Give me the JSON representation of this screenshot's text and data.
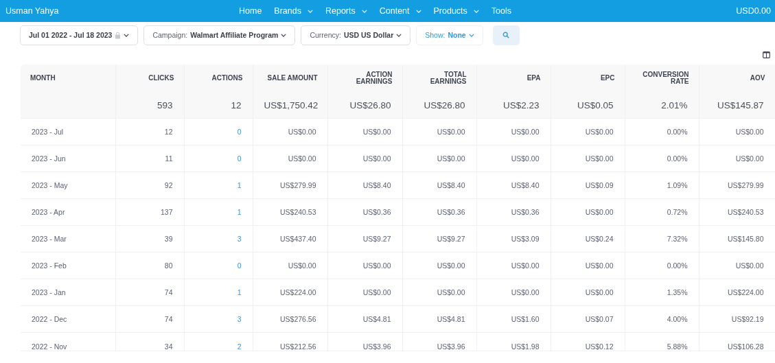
{
  "top_bar": {
    "user": "Usman Yahya",
    "nav": [
      {
        "label": "Home",
        "has_menu": false
      },
      {
        "label": "Brands",
        "has_menu": true
      },
      {
        "label": "Reports",
        "has_menu": true
      },
      {
        "label": "Content",
        "has_menu": true
      },
      {
        "label": "Products",
        "has_menu": true
      },
      {
        "label": "Tools",
        "has_menu": false
      }
    ],
    "balance": "USD0.00"
  },
  "filters": [
    {
      "kind": "date",
      "value": "Jul 01 2022 - Jul 18 2023"
    },
    {
      "kind": "select",
      "label": "Campaign:",
      "value": "Walmart Affiliate Program"
    },
    {
      "kind": "select",
      "label": "Currency:",
      "value": "USD US Dollar"
    },
    {
      "kind": "show",
      "label": "Show:",
      "value": "None"
    }
  ],
  "table": {
    "columns": [
      "MONTH",
      "CLICKS",
      "ACTIONS",
      "SALE AMOUNT",
      "ACTION EARNINGS",
      "TOTAL EARNINGS",
      "EPA",
      "EPC",
      "CONVERSION RATE",
      "AOV"
    ],
    "totals": [
      "593",
      "12",
      "US$1,750.42",
      "US$26.80",
      "US$26.80",
      "US$2.23",
      "US$0.05",
      "2.01%",
      "US$145.87"
    ],
    "rows": [
      [
        "2023 - Jul",
        "12",
        "0",
        "US$0.00",
        "US$0.00",
        "US$0.00",
        "US$0.00",
        "US$0.00",
        "0.00%",
        "US$0.00"
      ],
      [
        "2023 - Jun",
        "11",
        "0",
        "US$0.00",
        "US$0.00",
        "US$0.00",
        "US$0.00",
        "US$0.00",
        "0.00%",
        "US$0.00"
      ],
      [
        "2023 - May",
        "92",
        "1",
        "US$279.99",
        "US$8.40",
        "US$8.40",
        "US$8.40",
        "US$0.09",
        "1.09%",
        "US$279.99"
      ],
      [
        "2023 - Apr",
        "137",
        "1",
        "US$240.53",
        "US$0.36",
        "US$0.36",
        "US$0.36",
        "US$0.00",
        "0.72%",
        "US$240.53"
      ],
      [
        "2023 - Mar",
        "39",
        "3",
        "US$437.40",
        "US$9.27",
        "US$9.27",
        "US$3.09",
        "US$0.24",
        "7.32%",
        "US$145.80"
      ],
      [
        "2023 - Feb",
        "80",
        "0",
        "US$0.00",
        "US$0.00",
        "US$0.00",
        "US$0.00",
        "US$0.00",
        "0.00%",
        "US$0.00"
      ],
      [
        "2023 - Jan",
        "74",
        "1",
        "US$224.00",
        "US$0.00",
        "US$0.00",
        "US$0.00",
        "US$0.00",
        "1.35%",
        "US$224.00"
      ],
      [
        "2022 - Dec",
        "74",
        "3",
        "US$276.56",
        "US$4.81",
        "US$4.81",
        "US$1.60",
        "US$0.07",
        "4.00%",
        "US$92.19"
      ],
      [
        "2022 - Nov",
        "34",
        "2",
        "US$212.56",
        "US$3.96",
        "US$3.96",
        "US$1.98",
        "US$0.12",
        "5.88%",
        "US$106.28"
      ]
    ]
  }
}
